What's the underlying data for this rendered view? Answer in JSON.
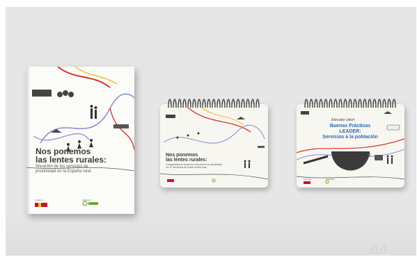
{
  "scene": {
    "background_color": "#e6e6e6",
    "accent_colors": {
      "red": "#d9322b",
      "yellow": "#f2c230",
      "purple": "#8a86d4",
      "blue_title": "#2a6ab5",
      "green_logo": "#6aaa3a"
    }
  },
  "book": {
    "title": "Nos ponemos\nlas lentes rurales:",
    "subtitle": "Situación de los servicios de\nproximidad en la España rural",
    "footer_left_label": "Impulsa:",
    "footer_right_label": "Organiza:"
  },
  "pad_left": {
    "title": "Nos ponemos\nlas lentes rurales:",
    "subtitle": "Comparativa de avances a servicios de proximidad\nen 11 comarcas de hasta media rural"
  },
  "pad_right": {
    "eyebrow": "Elevator pitch",
    "title": "Buenas Prácticas LEADER:\nServicios a la población",
    "footer_left_label": "Impulsa:",
    "footer_right_label": "Organiza:"
  }
}
